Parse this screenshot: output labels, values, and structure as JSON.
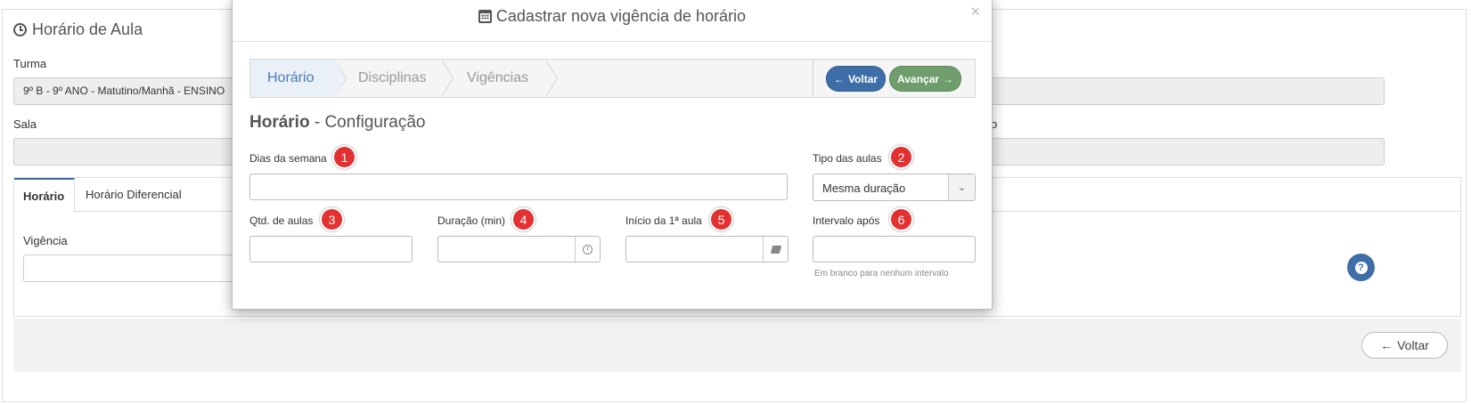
{
  "background": {
    "page_title": "Horário de Aula",
    "turma_label": "Turma",
    "turma_value": "9º B - 9º ANO - Matutino/Manhã - ENSINO",
    "sala_label": "Sala",
    "tabs": [
      "Horário",
      "Horário Diferencial"
    ],
    "vigencia_label": "Vigência",
    "right_label_fragment": "o",
    "voltar_label": "Voltar",
    "help_glyph": "?"
  },
  "modal": {
    "title": "Cadastrar nova vigência de horário",
    "close_glyph": "×",
    "steps": [
      "Horário",
      "Disciplinas",
      "Vigências"
    ],
    "btn_voltar": "Voltar",
    "btn_avancar": "Avançar",
    "section_title_bold": "Horário",
    "section_title_rest": " - Configuração",
    "fields": {
      "dias_semana": {
        "label": "Dias da semana",
        "badge": "1"
      },
      "tipo_aulas": {
        "label": "Tipo das aulas",
        "badge": "2",
        "value": "Mesma duração"
      },
      "qtd_aulas": {
        "label": "Qtd. de aulas",
        "badge": "3"
      },
      "duracao": {
        "label": "Duração (min)",
        "badge": "4"
      },
      "inicio_aula": {
        "label": "Início da 1ª aula",
        "badge": "5"
      },
      "intervalo": {
        "label": "Intervalo após",
        "badge": "6",
        "help": "Em branco para nenhum intervalo"
      }
    }
  },
  "colors": {
    "primary": "#3e6ea8",
    "success": "#6f9e6c",
    "badge": "#e33030"
  }
}
